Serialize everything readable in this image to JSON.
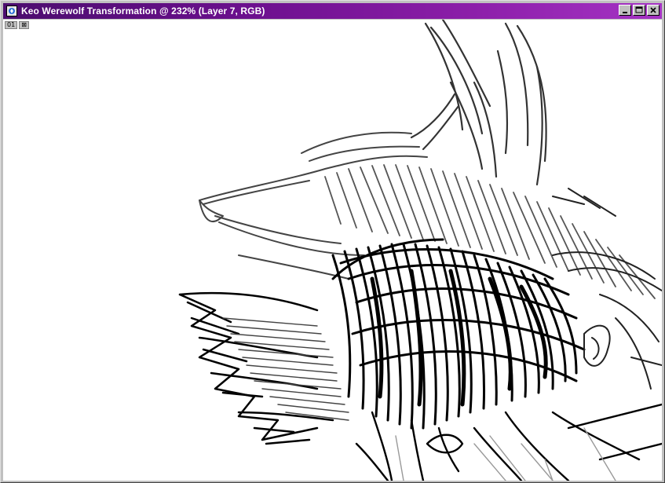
{
  "window": {
    "title": "Keo Werewolf Transformation @ 232% (Layer 7, RGB)",
    "buttons": {
      "minimize": "minimize-icon",
      "maximize": "maximize-icon",
      "close": "close-icon"
    },
    "title_gradient": [
      "#4b0d6e",
      "#a533c4"
    ]
  },
  "canvas": {
    "background": "#ffffff",
    "artwork": "sketch-of-werewolf-head",
    "tab_labels": [
      "01",
      "⊠"
    ]
  }
}
